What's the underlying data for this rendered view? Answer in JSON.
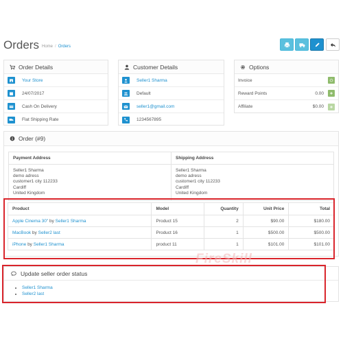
{
  "page": {
    "title": "Orders",
    "breadcrumbs": [
      "Home",
      "Orders"
    ]
  },
  "header_buttons": [
    {
      "name": "print-invoice-button",
      "icon": "print-icon"
    },
    {
      "name": "print-shipping-button",
      "icon": "truck-icon"
    },
    {
      "name": "edit-button",
      "icon": "pencil-icon"
    },
    {
      "name": "back-button",
      "icon": "reply-icon"
    }
  ],
  "order_details": {
    "heading": "Order Details",
    "store": "Your Store",
    "date": "24/07/2017",
    "payment_method": "Cash On Delivery",
    "shipping_method": "Flat Shipping Rate"
  },
  "customer_details": {
    "heading": "Customer Details",
    "name": "Seller1 Sharma",
    "group": "Default",
    "email": "seller1@gmail.com",
    "phone": "1234567895"
  },
  "options": {
    "heading": "Options",
    "rows": [
      {
        "label": "Invoice",
        "value": ""
      },
      {
        "label": "Reward Points",
        "value": "0.00"
      },
      {
        "label": "Affiliate",
        "value": "$0.00"
      }
    ]
  },
  "order": {
    "heading": "Order (#9)",
    "payment_address_label": "Payment Address",
    "shipping_address_label": "Shipping Address",
    "payment_address": [
      "Seller1 Sharma",
      "demo adress",
      "customer1 city 112233",
      "Cardiff",
      "United Kingdom"
    ],
    "shipping_address": [
      "Seller1 Sharma",
      "demo adress",
      "customer1 city 112233",
      "Cardiff",
      "United Kingdom"
    ]
  },
  "products": {
    "columns": [
      "Product",
      "Model",
      "Quantity",
      "Unit Price",
      "Total"
    ],
    "rows": [
      {
        "product": "Apple Cinema 30\"",
        "by": "by",
        "seller": "Seller1 Sharma",
        "model": "Product 15",
        "quantity": "2",
        "unit_price": "$90.00",
        "total": "$180.00"
      },
      {
        "product": "MacBook",
        "by": "by",
        "seller": "Seller2 last",
        "model": "Product 16",
        "quantity": "1",
        "unit_price": "$500.00",
        "total": "$500.00"
      },
      {
        "product": "iPhone",
        "by": "by",
        "seller": "Seller1 Sharma",
        "model": "product 11",
        "quantity": "1",
        "unit_price": "$101.00",
        "total": "$101.00"
      }
    ]
  },
  "update_status": {
    "heading": "Update seller order status",
    "sellers": [
      "Seller1 Sharma",
      "Seller2 last"
    ]
  },
  "watermark": "FireSkill",
  "colors": {
    "accent": "#1e91cf",
    "info": "#5bc0de",
    "success": "#8fbb6c",
    "highlight": "#d9242b"
  }
}
